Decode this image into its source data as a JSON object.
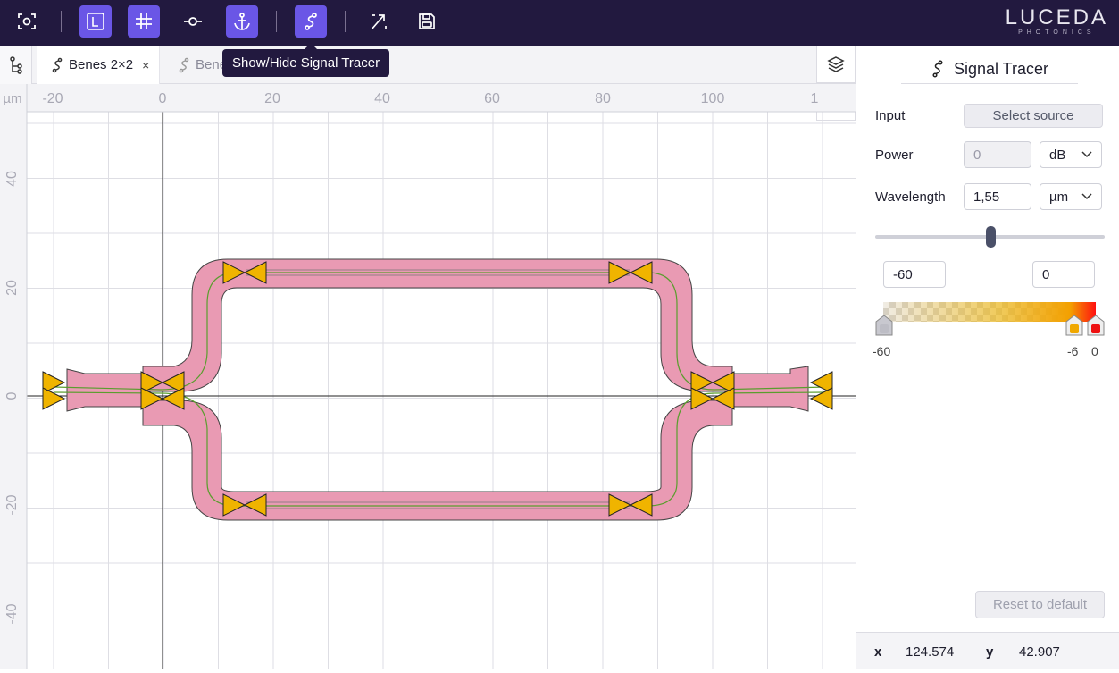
{
  "toolbar": {
    "tooltip": "Show/Hide Signal Tracer",
    "logo_main": "LUCEDA",
    "logo_sub": "PHOTONICS"
  },
  "tabs": [
    {
      "label": "Benes 2×2",
      "close": "×"
    },
    {
      "label": "Bene"
    }
  ],
  "canvas": {
    "unit": "µm",
    "x_ticks": [
      "-20",
      "0",
      "20",
      "40",
      "60",
      "80",
      "100",
      "1"
    ],
    "y_ticks": [
      "40",
      "20",
      "0",
      "-20",
      "-40"
    ]
  },
  "panel": {
    "title": "Signal Tracer",
    "input_label": "Input",
    "select_source": "Select source",
    "power_label": "Power",
    "power_value": "0",
    "power_unit": "dB",
    "wavelength_label": "Wavelength",
    "wavelength_value": "1,55",
    "wavelength_unit": "µm",
    "wavelength_slider_fraction": 0.5,
    "range_min": "-60",
    "range_max": "0",
    "scale_labels": {
      "left": "-60",
      "mid": "-6",
      "right": "0"
    },
    "reset_label": "Reset to default"
  },
  "status": {
    "x_label": "x",
    "x_value": "124.574",
    "y_label": "y",
    "y_value": "42.907"
  },
  "colors": {
    "toolbar_bg": "#22193f",
    "accent": "#6a56e6",
    "waveguide": "#e99ab3",
    "port": "#f0b400"
  }
}
